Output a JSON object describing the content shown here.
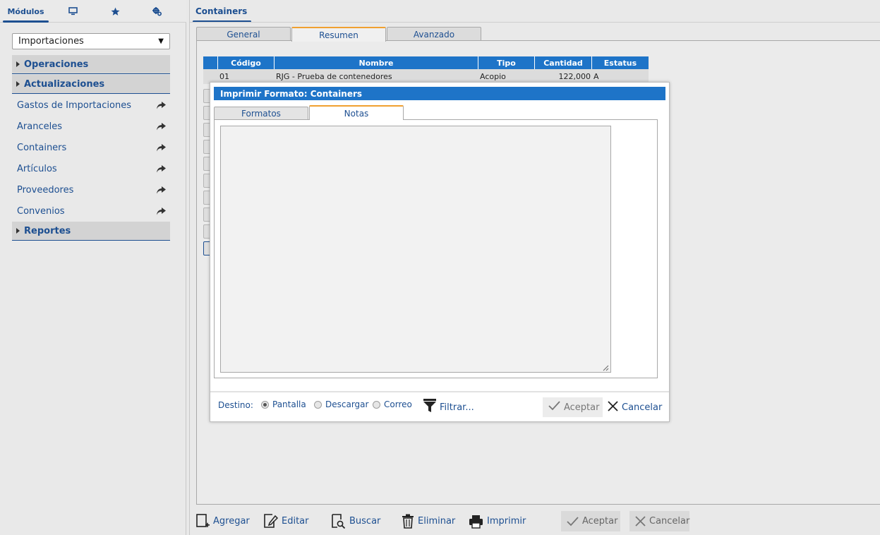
{
  "left_panel": {
    "tabs": [
      {
        "label": "Módulos",
        "active": true
      },
      {
        "icon": "monitor-icon"
      },
      {
        "icon": "star-icon"
      },
      {
        "icon": "gears-icon"
      }
    ],
    "module_select": {
      "value": "Importaciones"
    },
    "sections": [
      {
        "label": "Operaciones"
      },
      {
        "label": "Actualizaciones"
      },
      {
        "label": "Reportes"
      }
    ],
    "items": [
      {
        "label": "Gastos de Importaciones"
      },
      {
        "label": "Aranceles"
      },
      {
        "label": "Containers"
      },
      {
        "label": "Artículos"
      },
      {
        "label": "Proveedores"
      },
      {
        "label": "Convenios"
      }
    ]
  },
  "right_panel": {
    "page_tab": "Containers",
    "tabs": [
      {
        "label": "General"
      },
      {
        "label": "Resumen",
        "active": true
      },
      {
        "label": "Avanzado"
      }
    ],
    "grid": {
      "columns": [
        "Código",
        "Nombre",
        "Tipo",
        "Cantidad",
        "Estatus"
      ],
      "rows": [
        {
          "codigo": "01",
          "nombre": "RJG - Prueba de contenedores",
          "tipo": "Acopio",
          "cantidad": "122,000",
          "estatus": "A"
        }
      ]
    },
    "toolbar": {
      "add": "Agregar",
      "edit": "Editar",
      "search": "Buscar",
      "delete": "Eliminar",
      "print": "Imprimir",
      "accept": "Aceptar",
      "cancel": "Cancelar"
    }
  },
  "modal": {
    "title": "Imprimir Formato: Containers",
    "tabs": [
      {
        "label": "Formatos"
      },
      {
        "label": "Notas",
        "active": true
      }
    ],
    "notes_value": "",
    "footer": {
      "destino_label": "Destino:",
      "options": [
        {
          "label": "Pantalla",
          "selected": true
        },
        {
          "label": "Descargar",
          "selected": false
        },
        {
          "label": "Correo",
          "selected": false
        }
      ],
      "filter": "Filtrar...",
      "accept": "Aceptar",
      "cancel": "Cancelar"
    }
  },
  "colors": {
    "accent_blue": "#1d4f91",
    "header_blue": "#1e74c8",
    "active_tab_orange": "#f0a030"
  }
}
